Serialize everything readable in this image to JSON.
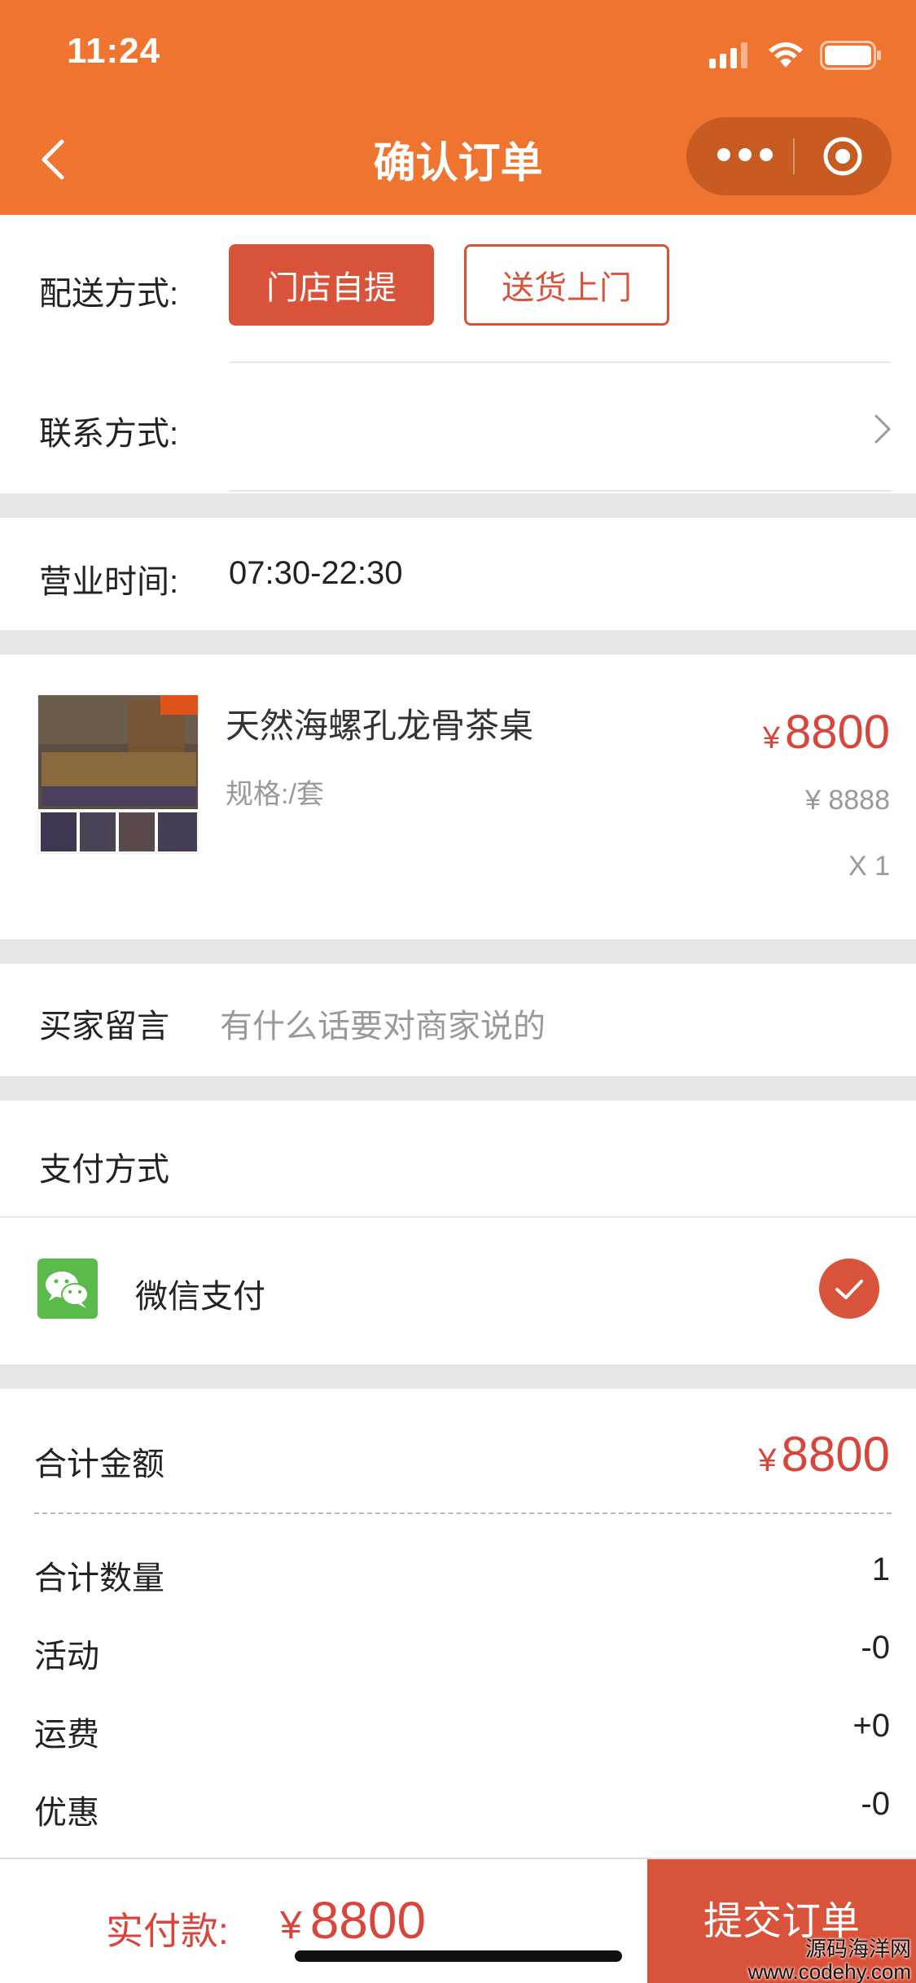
{
  "status_bar": {
    "time": "11:24"
  },
  "nav": {
    "title": "确认订单"
  },
  "delivery": {
    "label": "配送方式:",
    "options": [
      "门店自提",
      "送货上门"
    ],
    "selected": "门店自提"
  },
  "contact": {
    "label": "联系方式:"
  },
  "business_hours": {
    "label": "营业时间:",
    "value": "07:30-22:30"
  },
  "product": {
    "name": "天然海螺孔龙骨茶桌",
    "spec": "规格:/套",
    "currency": "¥",
    "price": "8800",
    "original_price": "¥ 8888",
    "quantity": "X 1"
  },
  "buyer_message": {
    "label": "买家留言",
    "placeholder": "有什么话要对商家说的"
  },
  "payment": {
    "section_title": "支付方式",
    "method": "微信支付",
    "method_icon": "wechat-icon",
    "selected": true
  },
  "summary": {
    "total_label": "合计金额",
    "total_currency": "¥",
    "total_value": "8800",
    "rows": [
      {
        "label": "合计数量",
        "value": "1"
      },
      {
        "label": "活动",
        "value": "-0"
      },
      {
        "label": "运费",
        "value": "+0"
      },
      {
        "label": "优惠",
        "value": "-0"
      }
    ]
  },
  "footer": {
    "pay_label": "实付款:",
    "currency": "¥",
    "amount": "8800",
    "submit_label": "提交订单"
  },
  "watermark": {
    "line1": "源码海洋网",
    "line2": "www.codehy.com"
  },
  "colors": {
    "header": "#ee7430",
    "accent": "#d9533a",
    "price": "#d9453a",
    "wechat": "#5aba4a"
  }
}
